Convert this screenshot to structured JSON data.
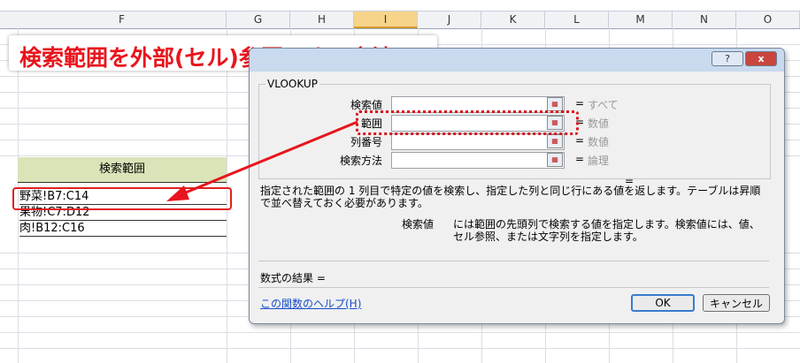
{
  "columns": [
    "F",
    "G",
    "H",
    "I",
    "J",
    "K",
    "L",
    "M",
    "N",
    "O"
  ],
  "selected_column": "I",
  "sheet": {
    "header": "検索範囲",
    "rows": [
      "野菜!B7:C14",
      "果物!C7:D12",
      "肉!B12:C16"
    ]
  },
  "annotation_title": "検索範囲を外部(セル)参照にする方法",
  "dialog": {
    "help_btn": "?",
    "close_btn": "x",
    "function_name": "VLOOKUP",
    "args": [
      {
        "label": "検索値",
        "value": "すべて"
      },
      {
        "label": "範囲",
        "value": "数値"
      },
      {
        "label": "列番号",
        "value": "数値"
      },
      {
        "label": "検索方法",
        "value": "論理"
      }
    ],
    "equals": "=",
    "description": "指定された範囲の 1 列目で特定の値を検索し、指定した列と同じ行にある値を返します。テーブルは昇順で並べ替えておく必要があります。",
    "arg_name": "検索値",
    "arg_help": "には範囲の先頭列で検索する値を指定します。検索値には、値、セル参照、または文字列を指定します。",
    "result_label": "数式の結果 =",
    "help_link": "この関数のヘルプ(H)",
    "ok_label": "OK",
    "cancel_label": "キャンセル"
  },
  "colors": {
    "accent_red": "#e8141c",
    "header_fill": "#d9e4b8",
    "selected_col": "#f7d48a"
  }
}
